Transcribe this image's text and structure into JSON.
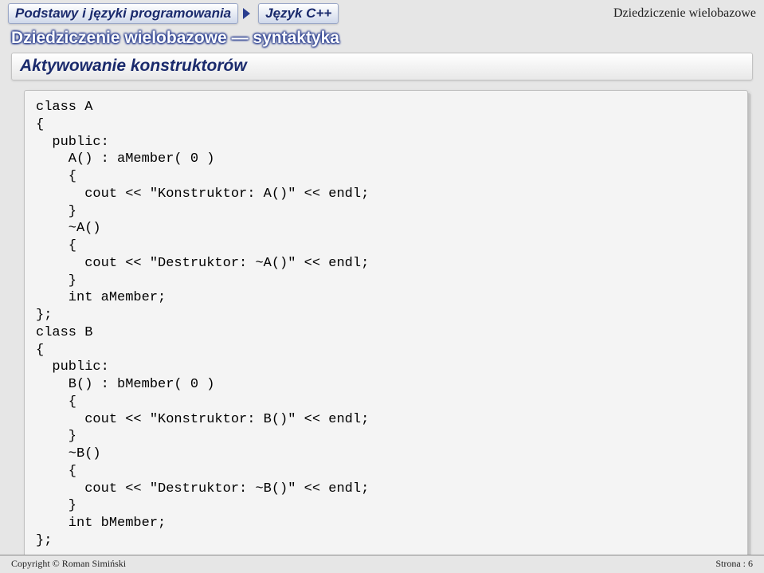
{
  "header": {
    "badge_left": "Podstawy i języki programowania",
    "badge_right": "Język C++",
    "topic_right": "Dziedziczenie wielobazowe",
    "subtitle": "Dziedziczenie wielobazowe — syntaktyka",
    "section_title": "Aktywowanie konstruktorów"
  },
  "code": "class A\n{\n  public:\n    A() : aMember( 0 )\n    {\n      cout << \"Konstruktor: A()\" << endl;\n    }\n    ~A()\n    {\n      cout << \"Destruktor: ~A()\" << endl;\n    }\n    int aMember;\n};\nclass B\n{\n  public:\n    B() : bMember( 0 )\n    {\n      cout << \"Konstruktor: B()\" << endl;\n    }\n    ~B()\n    {\n      cout << \"Destruktor: ~B()\" << endl;\n    }\n    int bMember;\n};",
  "footer": {
    "left": "Copyright © Roman Simiński",
    "right": "Strona : 6"
  }
}
